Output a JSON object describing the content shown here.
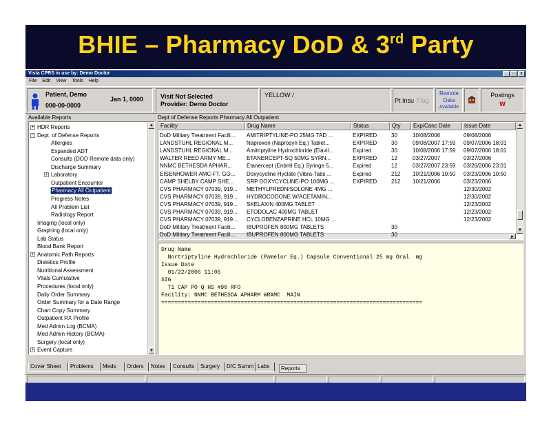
{
  "slide": {
    "title_main": "BHIE – Pharmacy DoD & 3",
    "title_sup": "rd",
    "title_end": " Party"
  },
  "window": {
    "title": "Vista CPRS in use by: Demo Doctor",
    "controls": [
      "_",
      "□",
      "x"
    ]
  },
  "menu": [
    "File",
    "Edit",
    "View",
    "Tools",
    "Help"
  ],
  "patient": {
    "name": "Patient, Demo",
    "ssn": "000-00-0000",
    "dob": "Jan 1, 0000",
    "visit": "Visit Not Selected",
    "provider": "Provider: Demo Doctor",
    "cwad": "YELLOW /",
    "pt_insu": "Pt Insu",
    "flag": "Flag",
    "remote_1": "Remote",
    "remote_2": "Data",
    "remote_3": "Available",
    "postings": "Postings",
    "postings_code": "W"
  },
  "left": {
    "header": "Available Reports",
    "items": [
      {
        "label": "HDR Reports",
        "level": 0,
        "expander": "+"
      },
      {
        "label": "Dept. of Defense Reports",
        "level": 0,
        "expander": "-"
      },
      {
        "label": "Allergies",
        "level": 1
      },
      {
        "label": "Expanded ADT",
        "level": 1
      },
      {
        "label": "Consults (DOD Remote data only)",
        "level": 1
      },
      {
        "label": "Discharge Summary",
        "level": 1
      },
      {
        "label": "Laboratory",
        "level": 1,
        "expander": "+"
      },
      {
        "label": "Outpatient Encounter",
        "level": 1
      },
      {
        "label": "Pharmacy All Outpatient",
        "level": 1,
        "selected": true
      },
      {
        "label": "Progress Notes",
        "level": 1
      },
      {
        "label": "All Problem List",
        "level": 1
      },
      {
        "label": "Radiology Report",
        "level": 1
      },
      {
        "label": "Imaging (local only)",
        "level": 0
      },
      {
        "label": "Graphing (local only)",
        "level": 0
      },
      {
        "label": "Lab Status",
        "level": 0
      },
      {
        "label": "Blood Bank Report",
        "level": 0
      },
      {
        "label": "Anatomic Path Reports",
        "level": 0,
        "expander": "+"
      },
      {
        "label": "Dietetics Profile",
        "level": 0
      },
      {
        "label": "Nutritional Assessment",
        "level": 0
      },
      {
        "label": "Vitals Cumulative",
        "level": 0
      },
      {
        "label": "Procedures (local only)",
        "level": 0
      },
      {
        "label": "Daily Order Summary",
        "level": 0
      },
      {
        "label": "Order Summary for a Date Range",
        "level": 0
      },
      {
        "label": "Chart Copy Summary",
        "level": 0
      },
      {
        "label": "Outpatient RX Profile",
        "level": 0
      },
      {
        "label": "Med Admin Log (BCMA)",
        "level": 0
      },
      {
        "label": "Med Admin History (BCMA)",
        "level": 0
      },
      {
        "label": "Surgery (local only)",
        "level": 0
      },
      {
        "label": "Event Capture",
        "level": 0,
        "expander": "+"
      }
    ]
  },
  "right": {
    "header": "Dept of Defense Reports Pharmacy All Outpatient",
    "columns": [
      "Facility",
      "Drug Name",
      "Status",
      "Qty",
      "Exp/Canc Date",
      "Issue Date"
    ],
    "rows": [
      [
        "DoD Military Treatment Facili...",
        "AMITRIPTYLINE-PO 25MG TAD ...",
        "EXPIRED",
        "30",
        "10/08/2006",
        "09/08/2006"
      ],
      [
        "LANDSTUHL REGIONAL M...",
        "Naproxen (Naprosyn Eq.) Tablet...",
        "EXPIRED",
        "30",
        "09/08/2007 17:59",
        "09/07/2006 18:01"
      ],
      [
        "LANDSTUHL REGIONAL M...",
        "Amitriptyline Hydrochloride (Elavil...",
        "Expired",
        "30",
        "10/08/2006 17:59",
        "09/07/2006 18:01"
      ],
      [
        "WALTER REED ARMY ME...",
        "ETANERCEPT-SQ 50MG SYRN...",
        "EXPIRED",
        "12",
        "03/27/2007",
        "03/27/2006"
      ],
      [
        "NNMC BETHESDA APHAR...",
        "Etanercept (Enbrel Eq.) Syringe 5...",
        "Expired",
        "12",
        "03/27/2007 23:59",
        "03/26/2006 23:01"
      ],
      [
        "EISENHOWER AMC-FT. GO...",
        "Doxycycline Hyclate (Vibra-Tabs ...",
        "Expired",
        "212",
        "10/21/2006 10:50",
        "03/23/2006 10:50"
      ],
      [
        "CAMP SHELBY CAMP SHE...",
        "SRP DOXYCYCLINE-PO 100MG ...",
        "EXPIRED",
        "212",
        "10/21/2006",
        "03/23/2006"
      ],
      [
        "CVS PHARMACY 07039, 919...",
        "METHYLPREDNISOLONE 4MG ...",
        "",
        "",
        "",
        "12/30/2002"
      ],
      [
        "CVS PHARMACY 07039, 919...",
        "HYDROCODONE W/ACETAMIN...",
        "",
        "",
        "",
        "12/30/2002"
      ],
      [
        "CVS PHARMACY 07039, 919...",
        "SKELAXIN 400MG TABLET",
        "",
        "",
        "",
        "12/23/2002"
      ],
      [
        "CVS PHARMACY 07039, 919...",
        "ETODOLAC 400MG TABLET",
        "",
        "",
        "",
        "12/23/2002"
      ],
      [
        "CVS PHARMACY 07039, 919...",
        "CYCLOBENZAPRINE HCL 10MG ...",
        "",
        "",
        "",
        "12/23/2002"
      ],
      [
        "DoD Military Treatment Facili...",
        "IBUPROFEN 800MG TABLETS",
        "",
        "30",
        "",
        ""
      ],
      [
        "DoD Military Treatment Facili...",
        "IBUPROFEN 800MG TABLETS",
        "",
        "30",
        "",
        ""
      ]
    ],
    "detail": [
      "Drug Name",
      "  Nortriptyline Hydrochloride (Pamelor Eq.) Capsule Conventional 25 mg Oral  mg",
      "Issue Date",
      "  01/22/2006 11:06",
      "SIG",
      "  T1 CAP PO Q HS #90 RFO",
      "Facility: NNMC BETHESDA APHARM WRAMC  MAIN",
      "==============================================================================="
    ]
  },
  "tabs": [
    "Cover Sheet",
    "Problems",
    "Meds",
    "Orders",
    "Notes",
    "Consults",
    "Surgery",
    "D/C Summ",
    "Labs",
    "Reports"
  ],
  "active_tab": "Reports"
}
